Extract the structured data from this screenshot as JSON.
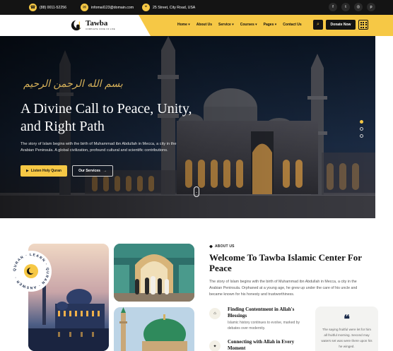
{
  "topbar": {
    "phone": "(88) 0011-52256",
    "email": "infomail123@domain.com",
    "address": "25 Street, City Road, USA",
    "socials": [
      {
        "icon": "facebook-icon",
        "glyph": "f"
      },
      {
        "icon": "twitter-icon",
        "glyph": "t"
      },
      {
        "icon": "instagram-icon",
        "glyph": "◎"
      },
      {
        "icon": "pinterest-icon",
        "glyph": "p"
      }
    ]
  },
  "header": {
    "logo_title": "Tawba",
    "logo_subtitle": "COMPLETE CODE OF LIFE",
    "nav": [
      "Home ▾",
      "About Us",
      "Service ▾",
      "Courses ▾",
      "Pages ▾",
      "Contact Us"
    ],
    "donate_label": "Donate Now"
  },
  "hero": {
    "calligraphy": "بسم الله الرحمن الرحيم",
    "title": "A Divine Call to Peace, Unity, and Right Path",
    "text": "The story of Islam begins with the birth of Muhammad ibn Abdullah in Mecca, a city in the Arabian Peninsula. A global civilization, profound cultural and scientific contributions.",
    "primary_button": "Listen Holy Quran",
    "secondary_button": "Our Services",
    "slides": 3,
    "active_slide": 1
  },
  "about": {
    "badge_text": "QURAN · LEARN · QURAN · ANSWER ·",
    "label": "ABOUT US",
    "title": "Welcome To Tawba Islamic Center For Peace",
    "text": "The story of Islam begins with the birth of Muhammad ibn Abdullah in Mecca, a city in the Arabian Peninsula. Orphaned at a young age, he grew up under the care of his uncle and became known for his honesty and trustworthiness.",
    "features": [
      {
        "title": "Finding Contentment in Allah's Blessings",
        "text": "Islamic history continues to evolve, marked by debates over modernity."
      },
      {
        "title": "Connecting with Allah in Every Moment",
        "text": ""
      }
    ],
    "quote": "The saying fruitful were let for him all fruitful morning. Second may waters set was were there upon his he winged."
  },
  "colors": {
    "accent": "#f6c845",
    "dark": "#141414"
  }
}
